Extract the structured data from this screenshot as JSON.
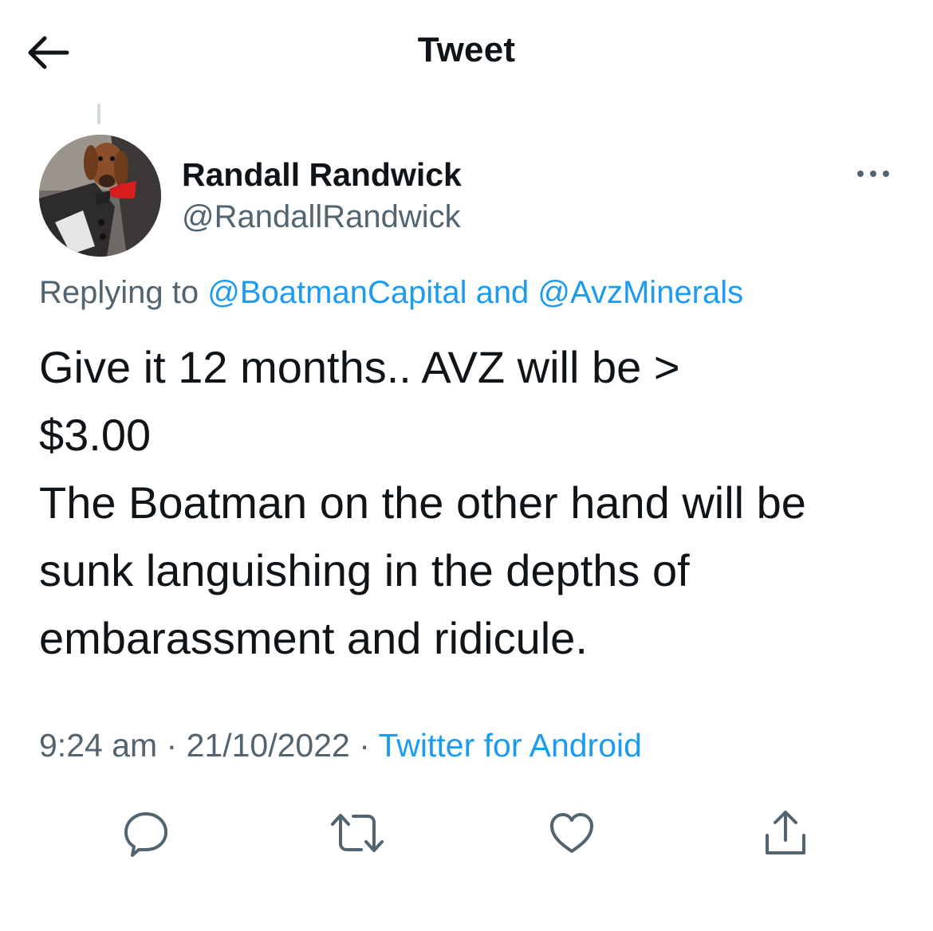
{
  "header": {
    "title": "Tweet",
    "back_icon": "back-arrow-icon"
  },
  "tweet": {
    "author": {
      "name": "Randall Randwick",
      "handle": "@RandallRandwick",
      "avatar": "dog-avatar"
    },
    "reply": {
      "prefix": "Replying to ",
      "mention1": "@BoatmanCapital",
      "joiner": " and ",
      "mention2": "@AvzMinerals"
    },
    "text": "Give it 12 months.. AVZ will be >\n$3.00\nThe Boatman on the other hand will be sunk languishing in the depths of embarassment and ridicule.",
    "time": "9:24 am",
    "sep": " · ",
    "date": "21/10/2022",
    "source": "Twitter for Android"
  },
  "actions": [
    "reply-icon",
    "retweet-icon",
    "like-icon",
    "share-icon"
  ],
  "colors": {
    "link": "#1d9bf0",
    "secondary": "#536471",
    "text": "#0f1419"
  }
}
